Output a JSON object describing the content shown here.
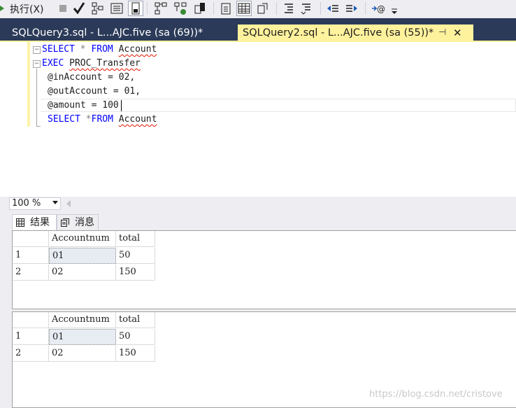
{
  "toolbar": {
    "execute_label": "执行(X)",
    "icons": [
      "play-icon",
      "stop-icon",
      "check-icon",
      "parse-icon",
      "results-to-text-icon",
      "results-to-file-icon",
      "plan-icon",
      "query-options-icon",
      "include-stats-icon",
      "results-to-grid-icon",
      "comment-icon",
      "uncomment-icon",
      "decrease-indent-icon",
      "increase-indent-icon",
      "specify-values-icon",
      "overflow-icon"
    ]
  },
  "tabs": [
    {
      "label": "SQLQuery3.sql - L...AJC.five (sa (69))*",
      "active": false
    },
    {
      "label": "SQLQuery2.sql - L...AJC.five (sa (55))*",
      "active": true,
      "pin": "⊣",
      "close": "✕"
    }
  ],
  "editor": {
    "lines": [
      {
        "kw": "SELECT",
        "rest1": " * ",
        "kw2": "FROM",
        "sp": " ",
        "id": "Account"
      },
      {
        "kw": "EXEC",
        "sp": " ",
        "id": "PROC_Transfer"
      },
      {
        "text": "@inAccount = 02,"
      },
      {
        "text": "@outAccount = 01,"
      },
      {
        "text": "@amount = 100"
      },
      {
        "kw": "SELECT",
        "rest1": " *",
        "kw2": "FROM",
        "sp": " ",
        "id": "Account"
      }
    ]
  },
  "zoom": {
    "value": "100 %"
  },
  "results_tabs": [
    {
      "label": "结果",
      "icon": "grid-icon"
    },
    {
      "label": "消息",
      "icon": "messages-icon"
    }
  ],
  "result_sets": [
    {
      "columns": [
        "Accountnum",
        "total"
      ],
      "rows": [
        {
          "num": "1",
          "cells": [
            "01",
            "50"
          ]
        },
        {
          "num": "2",
          "cells": [
            "02",
            "150"
          ]
        }
      ]
    },
    {
      "columns": [
        "Accountnum",
        "total"
      ],
      "rows": [
        {
          "num": "1",
          "cells": [
            "01",
            "50"
          ]
        },
        {
          "num": "2",
          "cells": [
            "02",
            "150"
          ]
        }
      ]
    }
  ],
  "watermark": "https://blog.csdn.net/cristove",
  "colors": {
    "tab_active": "#fff29d",
    "tab_strip": "#2b3a58",
    "keyword": "#0000ff"
  }
}
